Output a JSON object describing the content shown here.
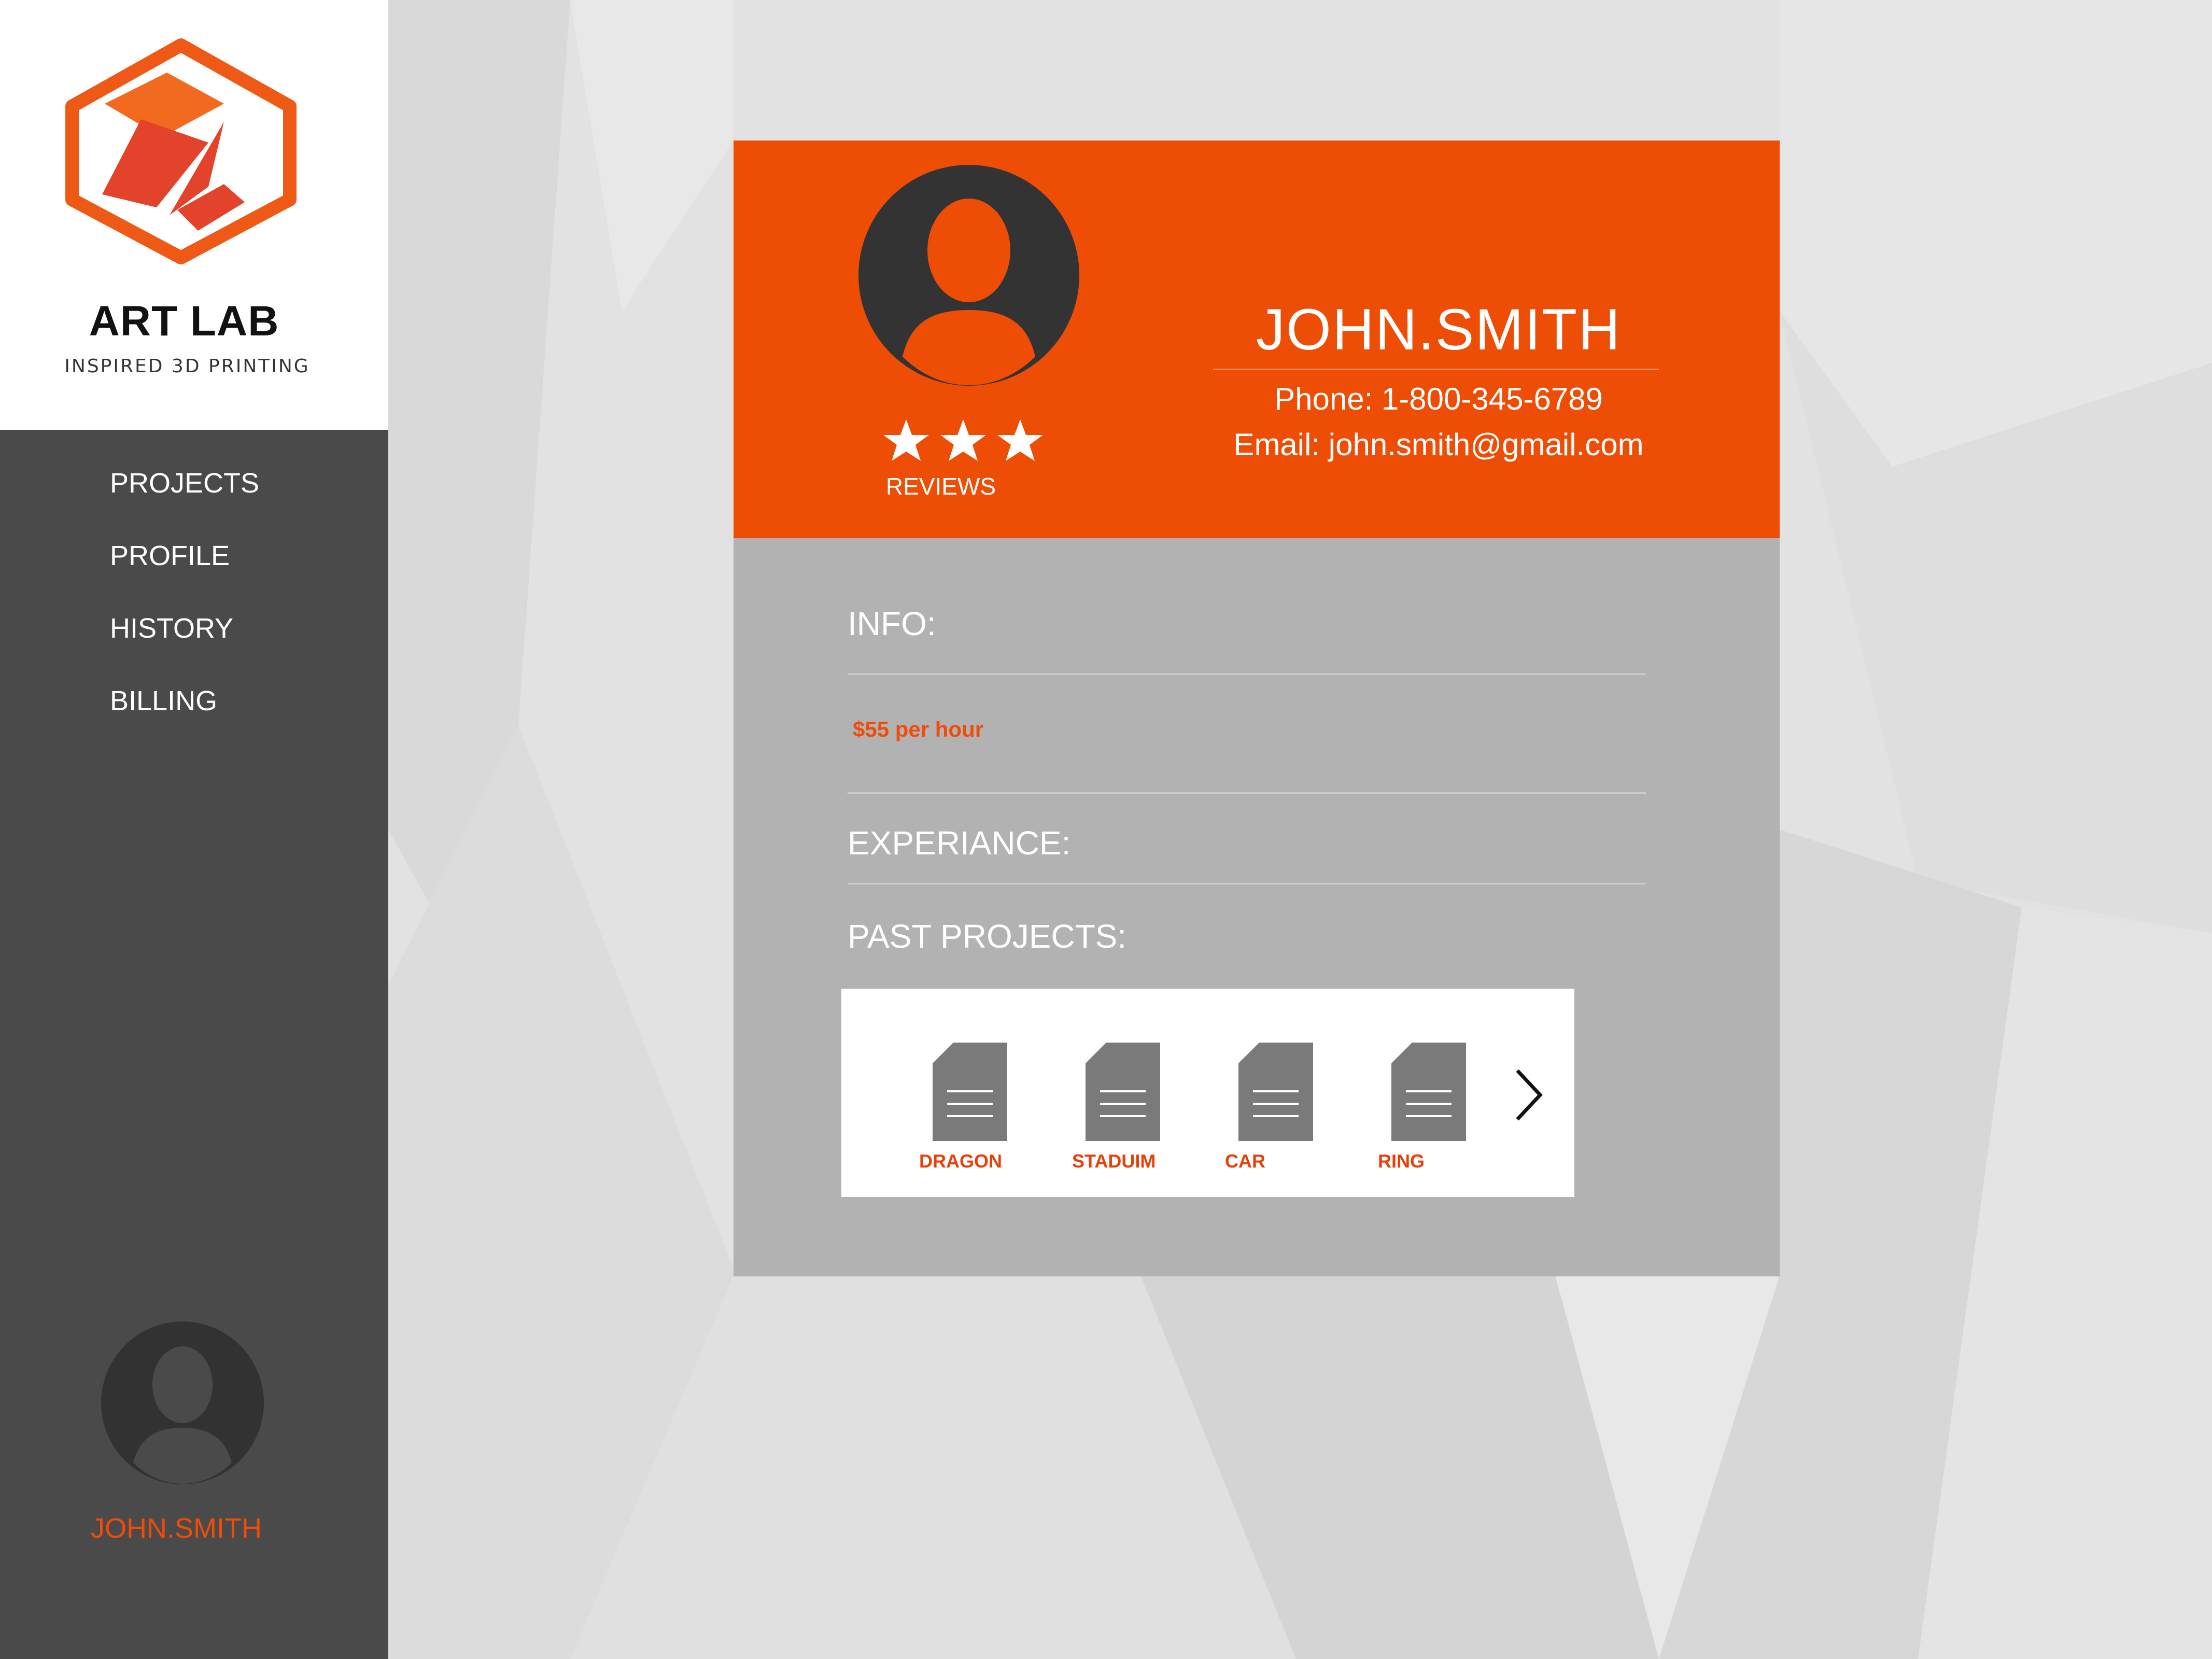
{
  "brand": {
    "name": "ART LAB",
    "tagline": "INSPIRED 3D PRINTING",
    "colors": {
      "accent": "#ee4d06",
      "sidebar": "#4a4a4a",
      "card": "#b2b2b2"
    }
  },
  "sidebar": {
    "items": [
      {
        "label": "PROJECTS"
      },
      {
        "label": "PROFILE"
      },
      {
        "label": "HISTORY"
      },
      {
        "label": "BILLING"
      }
    ],
    "user": {
      "name": "JOHN.SMITH",
      "icon": "avatar-icon"
    }
  },
  "profile": {
    "name": "JOHN.SMITH",
    "phone": "Phone: 1-800-345-6789",
    "email": "Email: john.smith@gmail.com",
    "rating": 3,
    "reviews_label": "REVIEWS",
    "info_label": "INFO:",
    "rate": "$55 per hour",
    "experience_label": "EXPERIANCE:",
    "past_projects_label": "PAST PROJECTS:",
    "projects": [
      {
        "label": "DRAGON",
        "icon": "document-icon"
      },
      {
        "label": "STADUIM",
        "icon": "document-icon"
      },
      {
        "label": "CAR",
        "icon": "document-icon"
      },
      {
        "label": "RING",
        "icon": "document-icon"
      }
    ],
    "next_icon": "chevron-right-icon"
  }
}
